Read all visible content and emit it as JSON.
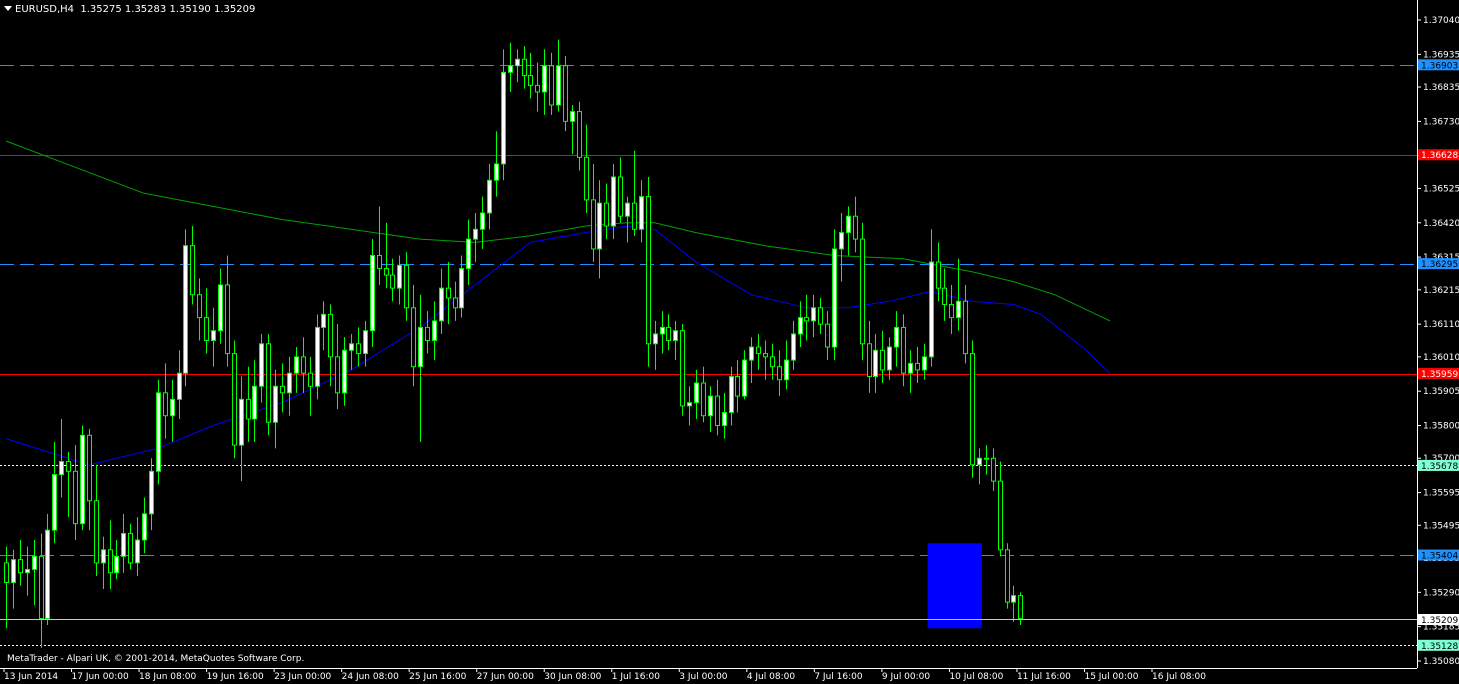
{
  "chart_header": {
    "symbol_timeframe": "EURUSD,H4",
    "ohlc": "1.35275 1.35283 1.35190 1.35209"
  },
  "copyright": "MetaTrader - Alpari UK, © 2001-2014, MetaQuotes Software Corp.",
  "colors": {
    "background": "#000000",
    "bull_candle": "#ffffff",
    "bear_candle": "#000000",
    "wick": "#00ff00",
    "ma_fast": "#0000ff",
    "ma_slow": "#00a000",
    "hline_blue": "#1e90ff",
    "hline_red": "#ff0000",
    "bid_line": "#c0c0ff",
    "axis_text": "#ffffff",
    "highlight_box": "#0000ff"
  },
  "chart_data": {
    "type": "candlestick",
    "symbol": "EURUSD",
    "timeframe": "H4",
    "y_ticks": [
      "1.37040",
      "1.36935",
      "1.36835",
      "1.36730",
      "1.36630",
      "1.36525",
      "1.36420",
      "1.36315",
      "1.36215",
      "1.36110",
      "1.36010",
      "1.35905",
      "1.35800",
      "1.35700",
      "1.35595",
      "1.35495",
      "1.35395",
      "1.35290",
      "1.35185",
      "1.35080"
    ],
    "ylim": [
      1.3506,
      1.371
    ],
    "x_tick_labels": [
      "13 Jun 2014",
      "17 Jun 00:00",
      "18 Jun 08:00",
      "19 Jun 16:00",
      "23 Jun 00:00",
      "24 Jun 08:00",
      "25 Jun 16:00",
      "27 Jun 00:00",
      "30 Jun 08:00",
      "1 Jul 16:00",
      "3 Jul 00:00",
      "4 Jul 08:00",
      "7 Jul 16:00",
      "9 Jul 00:00",
      "10 Jul 08:00",
      "11 Jul 16:00",
      "15 Jul 00:00",
      "16 Jul 08:00"
    ],
    "horizontal_lines": [
      {
        "price": 1.36903,
        "label": "1.36903",
        "color": "#1e90ff",
        "style": "dashed"
      },
      {
        "price": 1.36628,
        "label": "1.36628",
        "color": "#ff0000",
        "style": "solid"
      },
      {
        "price": 1.36295,
        "label": "1.36295",
        "color": "#1e90ff",
        "style": "dashed"
      },
      {
        "price": 1.35959,
        "label": "1.35959",
        "color": "#ff0000",
        "style": "solid"
      },
      {
        "price": 1.35678,
        "label": "1.35678",
        "color": "#ffffff",
        "style": "dotted"
      },
      {
        "price": 1.35404,
        "label": "1.35404",
        "color": "#1e90ff",
        "style": "dashed"
      },
      {
        "price": 1.35128,
        "label": "1.35128",
        "color": "#ffffff",
        "style": "dotted"
      }
    ],
    "current_price": "1.35209",
    "highlight_box": {
      "price_top": 1.3544,
      "price_bottom": 1.3518,
      "from_candle": 134,
      "to_candle": 141
    },
    "ohlc": [
      [
        1.3538,
        1.3543,
        1.3518,
        1.3532
      ],
      [
        1.3532,
        1.3542,
        1.3524,
        1.3539
      ],
      [
        1.3539,
        1.3545,
        1.3531,
        1.3535
      ],
      [
        1.3535,
        1.3543,
        1.3528,
        1.3536
      ],
      [
        1.3536,
        1.3545,
        1.3525,
        1.354
      ],
      [
        1.354,
        1.3547,
        1.3512,
        1.3521
      ],
      [
        1.3521,
        1.3553,
        1.3519,
        1.3548
      ],
      [
        1.3548,
        1.3575,
        1.3544,
        1.3565
      ],
      [
        1.3565,
        1.3582,
        1.3558,
        1.3569
      ],
      [
        1.3569,
        1.3572,
        1.3552,
        1.3566
      ],
      [
        1.3566,
        1.3574,
        1.3545,
        1.355
      ],
      [
        1.355,
        1.358,
        1.3548,
        1.3577
      ],
      [
        1.3577,
        1.3579,
        1.3548,
        1.3557
      ],
      [
        1.3557,
        1.3568,
        1.3534,
        1.3538
      ],
      [
        1.3538,
        1.3546,
        1.353,
        1.3542
      ],
      [
        1.3542,
        1.3551,
        1.353,
        1.3535
      ],
      [
        1.3535,
        1.3545,
        1.3533,
        1.354
      ],
      [
        1.354,
        1.3553,
        1.3535,
        1.3547
      ],
      [
        1.3547,
        1.355,
        1.3536,
        1.3538
      ],
      [
        1.3538,
        1.3552,
        1.3534,
        1.3545
      ],
      [
        1.3545,
        1.3558,
        1.3541,
        1.3553
      ],
      [
        1.3553,
        1.357,
        1.3548,
        1.3566
      ],
      [
        1.3566,
        1.3594,
        1.3562,
        1.359
      ],
      [
        1.359,
        1.3599,
        1.3576,
        1.3583
      ],
      [
        1.3583,
        1.3594,
        1.3575,
        1.3588
      ],
      [
        1.3588,
        1.3603,
        1.3582,
        1.3596
      ],
      [
        1.3596,
        1.364,
        1.3592,
        1.3635
      ],
      [
        1.3635,
        1.3641,
        1.3617,
        1.362
      ],
      [
        1.362,
        1.3625,
        1.3606,
        1.3613
      ],
      [
        1.3613,
        1.3622,
        1.3602,
        1.3606
      ],
      [
        1.3606,
        1.3616,
        1.3598,
        1.3609
      ],
      [
        1.3609,
        1.3628,
        1.3605,
        1.3623
      ],
      [
        1.3623,
        1.3632,
        1.3598,
        1.3602
      ],
      [
        1.3602,
        1.3606,
        1.357,
        1.3574
      ],
      [
        1.3574,
        1.3595,
        1.3563,
        1.3588
      ],
      [
        1.3588,
        1.3598,
        1.3575,
        1.3582
      ],
      [
        1.3582,
        1.36,
        1.3575,
        1.3592
      ],
      [
        1.3592,
        1.3608,
        1.3587,
        1.3605
      ],
      [
        1.3605,
        1.3608,
        1.3577,
        1.3581
      ],
      [
        1.3581,
        1.3597,
        1.3573,
        1.3592
      ],
      [
        1.3592,
        1.3599,
        1.3584,
        1.359
      ],
      [
        1.359,
        1.3601,
        1.3583,
        1.3596
      ],
      [
        1.3596,
        1.3604,
        1.359,
        1.3601
      ],
      [
        1.3601,
        1.3607,
        1.359,
        1.3596
      ],
      [
        1.3596,
        1.3601,
        1.3583,
        1.3592
      ],
      [
        1.3592,
        1.3614,
        1.3588,
        1.361
      ],
      [
        1.361,
        1.3618,
        1.3603,
        1.3614
      ],
      [
        1.3614,
        1.3617,
        1.3592,
        1.3601
      ],
      [
        1.3601,
        1.3611,
        1.3585,
        1.359
      ],
      [
        1.359,
        1.3607,
        1.3586,
        1.3603
      ],
      [
        1.3603,
        1.3608,
        1.3597,
        1.3605
      ],
      [
        1.3605,
        1.361,
        1.3598,
        1.3602
      ],
      [
        1.3602,
        1.3612,
        1.3598,
        1.3609
      ],
      [
        1.3609,
        1.3637,
        1.3604,
        1.3632
      ],
      [
        1.3632,
        1.3647,
        1.3623,
        1.3628
      ],
      [
        1.3628,
        1.3642,
        1.3622,
        1.3626
      ],
      [
        1.3626,
        1.3631,
        1.3618,
        1.3622
      ],
      [
        1.3622,
        1.3632,
        1.3617,
        1.3629
      ],
      [
        1.3629,
        1.3633,
        1.3612,
        1.3616
      ],
      [
        1.3616,
        1.3623,
        1.3592,
        1.3598
      ],
      [
        1.3598,
        1.362,
        1.3575,
        1.361
      ],
      [
        1.361,
        1.3615,
        1.3602,
        1.3606
      ],
      [
        1.3606,
        1.3618,
        1.36,
        1.3612
      ],
      [
        1.3612,
        1.3628,
        1.3608,
        1.3622
      ],
      [
        1.3622,
        1.363,
        1.3611,
        1.3619
      ],
      [
        1.3619,
        1.3624,
        1.3612,
        1.3616
      ],
      [
        1.3616,
        1.3632,
        1.3613,
        1.3628
      ],
      [
        1.3628,
        1.3643,
        1.3623,
        1.3637
      ],
      [
        1.3637,
        1.3645,
        1.363,
        1.364
      ],
      [
        1.364,
        1.365,
        1.3634,
        1.3645
      ],
      [
        1.3645,
        1.366,
        1.364,
        1.3655
      ],
      [
        1.3655,
        1.367,
        1.365,
        1.366
      ],
      [
        1.366,
        1.3695,
        1.3655,
        1.3688
      ],
      [
        1.3688,
        1.3697,
        1.3682,
        1.369
      ],
      [
        1.369,
        1.3695,
        1.3685,
        1.3692
      ],
      [
        1.3692,
        1.3696,
        1.3683,
        1.3687
      ],
      [
        1.3687,
        1.3694,
        1.368,
        1.3684
      ],
      [
        1.3684,
        1.3691,
        1.3676,
        1.3682
      ],
      [
        1.3682,
        1.3695,
        1.3675,
        1.369
      ],
      [
        1.369,
        1.3694,
        1.3675,
        1.3678
      ],
      [
        1.3678,
        1.3698,
        1.3676,
        1.369
      ],
      [
        1.369,
        1.3693,
        1.367,
        1.3673
      ],
      [
        1.3673,
        1.3678,
        1.3663,
        1.3676
      ],
      [
        1.3676,
        1.3679,
        1.3658,
        1.3662
      ],
      [
        1.3662,
        1.3672,
        1.3645,
        1.3649
      ],
      [
        1.3649,
        1.366,
        1.363,
        1.3634
      ],
      [
        1.3634,
        1.3655,
        1.3625,
        1.3648
      ],
      [
        1.3648,
        1.3654,
        1.3637,
        1.3641
      ],
      [
        1.3641,
        1.366,
        1.3637,
        1.3656
      ],
      [
        1.3656,
        1.3662,
        1.3642,
        1.3644
      ],
      [
        1.3644,
        1.365,
        1.3636,
        1.3648
      ],
      [
        1.3648,
        1.3664,
        1.3638,
        1.364
      ],
      [
        1.364,
        1.3655,
        1.3636,
        1.365
      ],
      [
        1.365,
        1.3656,
        1.3598,
        1.3605
      ],
      [
        1.3605,
        1.3612,
        1.3597,
        1.3608
      ],
      [
        1.3608,
        1.3615,
        1.3602,
        1.361
      ],
      [
        1.361,
        1.3614,
        1.3603,
        1.3606
      ],
      [
        1.3606,
        1.3612,
        1.36,
        1.3609
      ],
      [
        1.3609,
        1.3611,
        1.3583,
        1.3586
      ],
      [
        1.3586,
        1.3592,
        1.358,
        1.3587
      ],
      [
        1.3587,
        1.3597,
        1.3582,
        1.3593
      ],
      [
        1.3593,
        1.3598,
        1.3581,
        1.3583
      ],
      [
        1.3583,
        1.3592,
        1.3578,
        1.3589
      ],
      [
        1.3589,
        1.3594,
        1.3577,
        1.358
      ],
      [
        1.358,
        1.359,
        1.3576,
        1.3584
      ],
      [
        1.3584,
        1.3598,
        1.358,
        1.3595
      ],
      [
        1.3595,
        1.36,
        1.3584,
        1.3589
      ],
      [
        1.3589,
        1.3603,
        1.3588,
        1.36
      ],
      [
        1.36,
        1.3607,
        1.3593,
        1.3604
      ],
      [
        1.3604,
        1.3608,
        1.3597,
        1.3602
      ],
      [
        1.3602,
        1.3606,
        1.3594,
        1.3601
      ],
      [
        1.3601,
        1.3605,
        1.3594,
        1.3598
      ],
      [
        1.3598,
        1.3603,
        1.3589,
        1.3594
      ],
      [
        1.3594,
        1.3606,
        1.3591,
        1.36
      ],
      [
        1.36,
        1.3612,
        1.3597,
        1.3608
      ],
      [
        1.3608,
        1.3618,
        1.3604,
        1.3613
      ],
      [
        1.3613,
        1.362,
        1.3606,
        1.3612
      ],
      [
        1.3612,
        1.362,
        1.3607,
        1.3616
      ],
      [
        1.3616,
        1.3619,
        1.3608,
        1.3611
      ],
      [
        1.3611,
        1.3615,
        1.36,
        1.3604
      ],
      [
        1.3604,
        1.364,
        1.36,
        1.3634
      ],
      [
        1.3634,
        1.3645,
        1.3624,
        1.3639
      ],
      [
        1.3639,
        1.3647,
        1.3632,
        1.3644
      ],
      [
        1.3644,
        1.365,
        1.3633,
        1.3637
      ],
      [
        1.3637,
        1.3642,
        1.36,
        1.3605
      ],
      [
        1.3605,
        1.3612,
        1.359,
        1.3595
      ],
      [
        1.3595,
        1.3608,
        1.359,
        1.3603
      ],
      [
        1.3603,
        1.3609,
        1.3593,
        1.3597
      ],
      [
        1.3597,
        1.3607,
        1.3594,
        1.3604
      ],
      [
        1.3604,
        1.3615,
        1.3598,
        1.361
      ],
      [
        1.361,
        1.3614,
        1.3592,
        1.3596
      ],
      [
        1.3596,
        1.3603,
        1.359,
        1.3599
      ],
      [
        1.3599,
        1.3604,
        1.3593,
        1.3597
      ],
      [
        1.3597,
        1.3605,
        1.3594,
        1.3601
      ],
      [
        1.3601,
        1.364,
        1.3598,
        1.363
      ],
      [
        1.363,
        1.3636,
        1.3618,
        1.3622
      ],
      [
        1.3622,
        1.3628,
        1.3612,
        1.3617
      ],
      [
        1.3617,
        1.3623,
        1.3608,
        1.3613
      ],
      [
        1.3613,
        1.3631,
        1.3609,
        1.3618
      ],
      [
        1.3618,
        1.3623,
        1.3599,
        1.3602
      ],
      [
        1.3602,
        1.3606,
        1.3564,
        1.3568
      ],
      [
        1.3568,
        1.3573,
        1.3562,
        1.357
      ],
      [
        1.357,
        1.3574,
        1.3565,
        1.357
      ],
      [
        1.357,
        1.3573,
        1.356,
        1.3563
      ],
      [
        1.3563,
        1.3569,
        1.354,
        1.3542
      ],
      [
        1.3542,
        1.3544,
        1.3524,
        1.3526
      ],
      [
        1.3526,
        1.3531,
        1.352,
        1.3528
      ],
      [
        1.3528,
        1.3529,
        1.3519,
        1.3521
      ]
    ],
    "ma_fast": [
      [
        0,
        1.3576
      ],
      [
        12,
        1.3568
      ],
      [
        22,
        1.3573
      ],
      [
        30,
        1.358
      ],
      [
        40,
        1.3587
      ],
      [
        50,
        1.3597
      ],
      [
        60,
        1.361
      ],
      [
        68,
        1.3623
      ],
      [
        76,
        1.3636
      ],
      [
        84,
        1.3639
      ],
      [
        90,
        1.3641
      ],
      [
        94,
        1.364
      ],
      [
        100,
        1.363
      ],
      [
        108,
        1.362
      ],
      [
        116,
        1.3616
      ],
      [
        122,
        1.3616
      ],
      [
        128,
        1.3618
      ],
      [
        134,
        1.3621
      ],
      [
        140,
        1.3618
      ],
      [
        146,
        1.3617
      ],
      [
        150,
        1.3614
      ],
      [
        156,
        1.3604
      ],
      [
        160,
        1.3596
      ]
    ],
    "ma_slow": [
      [
        0,
        1.3667
      ],
      [
        10,
        1.3659
      ],
      [
        20,
        1.3651
      ],
      [
        30,
        1.3647
      ],
      [
        40,
        1.3643
      ],
      [
        50,
        1.364
      ],
      [
        60,
        1.3637
      ],
      [
        68,
        1.3636
      ],
      [
        76,
        1.3638
      ],
      [
        84,
        1.3641
      ],
      [
        90,
        1.3642
      ],
      [
        94,
        1.3642
      ],
      [
        100,
        1.3639
      ],
      [
        110,
        1.3635
      ],
      [
        120,
        1.3632
      ],
      [
        130,
        1.3631
      ],
      [
        140,
        1.3627
      ],
      [
        146,
        1.3624
      ],
      [
        152,
        1.362
      ],
      [
        160,
        1.3612
      ]
    ]
  }
}
